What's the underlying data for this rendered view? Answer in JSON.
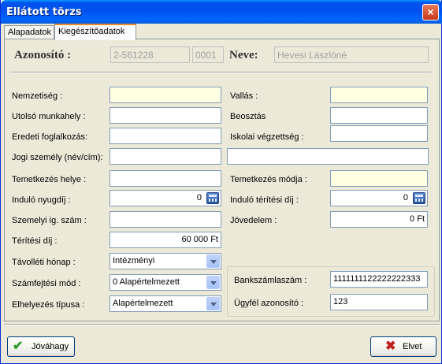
{
  "window": {
    "title": "Ellátott törzs",
    "close_glyph": "×"
  },
  "tabs": [
    {
      "label": "Alapadatok",
      "active": false
    },
    {
      "label": "Kiegészítőadatok",
      "active": true
    }
  ],
  "header": {
    "id_label": "Azonosító :",
    "id_value": "2-561228",
    "id_suffix": "0001",
    "name_label": "Neve:",
    "name_value": "Hevesi Lászlóné"
  },
  "left": {
    "nemzetiseg": {
      "label": "Nemzetiség :",
      "value": ""
    },
    "utolso": {
      "label": "Utolsó munkahely :",
      "value": ""
    },
    "eredeti": {
      "label": "Eredeti foglalkozás:",
      "value": ""
    },
    "jogi": {
      "label": "Jogi személy (név/cím):",
      "value": "",
      "value2": ""
    },
    "temetkezes_helye": {
      "label": "Temetkezés helye :",
      "value": ""
    },
    "nyugdij": {
      "label": "Induló nyugdíj :",
      "value": "0"
    },
    "szemelyi": {
      "label": "Szemelyi ig. szám :",
      "value": ""
    },
    "teritesi": {
      "label": "Térítési díj :",
      "value": "60 000 Ft"
    },
    "tavolleti": {
      "label": "Távolléti hónap :",
      "value": "Intézményi"
    },
    "szamfejtesi": {
      "label": "Számfejtési mód :",
      "value": "0 Alapértelmezett"
    },
    "elhelyezes": {
      "label": "Elhelyezés típusa :",
      "value": "Alapértelmezett"
    }
  },
  "right": {
    "vallas": {
      "label": "Vallás :",
      "value": ""
    },
    "beosztas": {
      "label": "Beosztás",
      "value": ""
    },
    "iskolai": {
      "label": "Iskolai végzettség :",
      "value": ""
    },
    "temetkezes_modja": {
      "label": "Temetkezés módja :",
      "value": ""
    },
    "teritesi_dij": {
      "label": "Induló térítési díj :",
      "value": "0"
    },
    "jovedelem": {
      "label": "Jövedelem :",
      "value": "0 Ft"
    }
  },
  "bank": {
    "szamla_label": "Bankszámlaszám :",
    "szamla_value": "1111111122222222333",
    "ugyfel_label": "Ügyfél azonosító :",
    "ugyfel_value": "123"
  },
  "buttons": {
    "ok_label": "Jóváhagy",
    "cancel_label": "Elvet",
    "ok_icon": "✔",
    "cancel_icon": "✖"
  }
}
